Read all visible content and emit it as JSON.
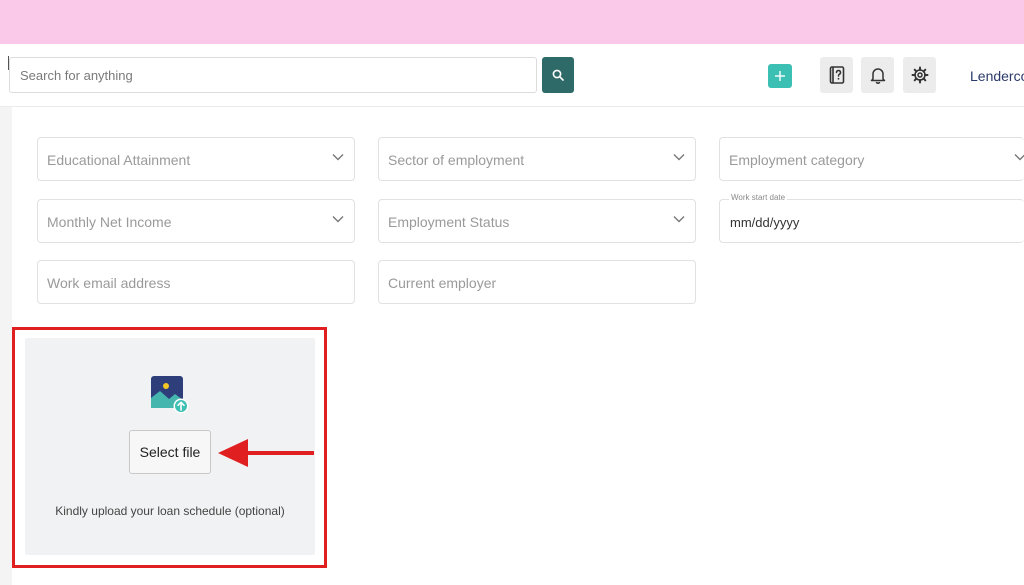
{
  "header": {
    "search_placeholder": "Search for anything",
    "brand": "Lenderco"
  },
  "icons": {
    "search": "search-icon",
    "add": "plus-icon",
    "help": "help-book-icon",
    "notifications": "bell-icon",
    "settings": "gear-icon",
    "upload": "image-upload-icon",
    "arrow": "red-arrow-left-icon"
  },
  "form": {
    "row1": {
      "education": "Educational Attainment",
      "sector": "Sector of employment",
      "category": "Employment category"
    },
    "row2": {
      "income": "Monthly Net Income",
      "status": "Employment Status",
      "work_start_label": "Work start date",
      "work_start_value": "mm/dd/yyyy"
    },
    "row3": {
      "work_email": "Work email address",
      "employer": "Current employer"
    }
  },
  "upload": {
    "button_label": "Select file",
    "caption": "Kindly upload your loan schedule (optional)"
  },
  "colors": {
    "top_band": "#fac8e8",
    "primary_dark": "#2e6b68",
    "accent": "#3cc0b4",
    "highlight": "#e02020"
  }
}
